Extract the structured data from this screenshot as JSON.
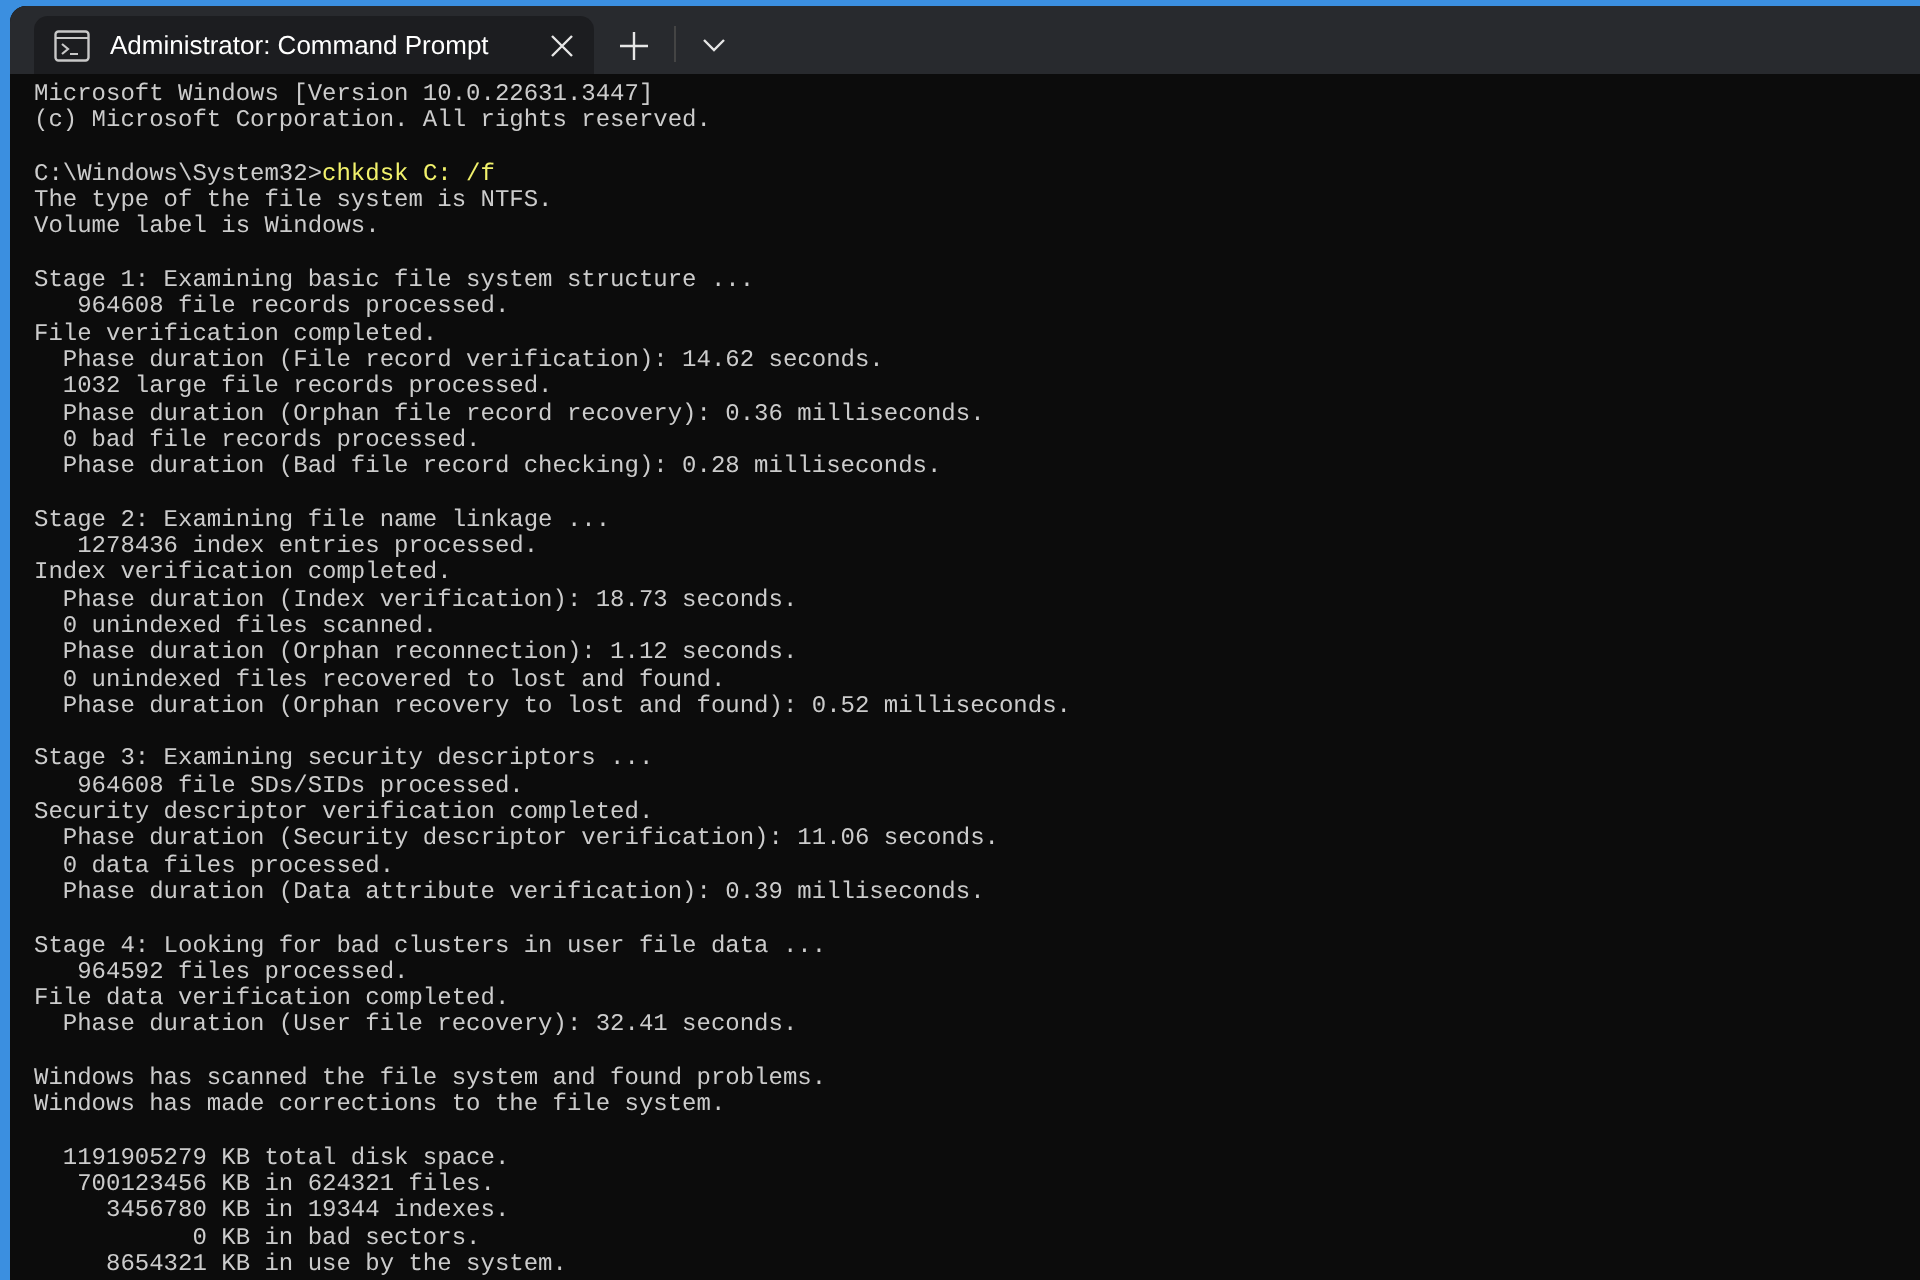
{
  "window": {
    "tabs": [
      {
        "title": "Administrator: Command Prompt",
        "selected": true
      }
    ]
  },
  "console": {
    "blocks": [
      [
        {
          "kind": "output",
          "text": "Microsoft Windows [Version 10.0.22631.3447]"
        },
        {
          "kind": "output",
          "text": "(c) Microsoft Corporation. All rights reserved."
        }
      ],
      [
        {
          "kind": "command",
          "prompt": "C:\\Windows\\System32>",
          "text": "chkdsk C: /f"
        },
        {
          "kind": "output",
          "text": "The type of the file system is NTFS."
        },
        {
          "kind": "output",
          "text": "Volume label is Windows."
        }
      ],
      [
        {
          "kind": "output",
          "text": "Stage 1: Examining basic file system structure ..."
        },
        {
          "kind": "output",
          "text": "   964608 file records processed."
        },
        {
          "kind": "output",
          "text": "File verification completed."
        },
        {
          "kind": "output",
          "text": "  Phase duration (File record verification): 14.62 seconds."
        },
        {
          "kind": "output",
          "text": "  1032 large file records processed."
        },
        {
          "kind": "output",
          "text": "  Phase duration (Orphan file record recovery): 0.36 milliseconds."
        },
        {
          "kind": "output",
          "text": "  0 bad file records processed."
        },
        {
          "kind": "output",
          "text": "  Phase duration (Bad file record checking): 0.28 milliseconds."
        }
      ],
      [
        {
          "kind": "output",
          "text": "Stage 2: Examining file name linkage ..."
        },
        {
          "kind": "output",
          "text": "   1278436 index entries processed."
        },
        {
          "kind": "output",
          "text": "Index verification completed."
        },
        {
          "kind": "output",
          "text": "  Phase duration (Index verification): 18.73 seconds."
        },
        {
          "kind": "output",
          "text": "  0 unindexed files scanned."
        },
        {
          "kind": "output",
          "text": "  Phase duration (Orphan reconnection): 1.12 seconds."
        },
        {
          "kind": "output",
          "text": "  0 unindexed files recovered to lost and found."
        },
        {
          "kind": "output",
          "text": "  Phase duration (Orphan recovery to lost and found): 0.52 milliseconds."
        }
      ],
      [
        {
          "kind": "output",
          "text": "Stage 3: Examining security descriptors ..."
        },
        {
          "kind": "output",
          "text": "   964608 file SDs/SIDs processed."
        },
        {
          "kind": "output",
          "text": "Security descriptor verification completed."
        },
        {
          "kind": "output",
          "text": "  Phase duration (Security descriptor verification): 11.06 seconds."
        },
        {
          "kind": "output",
          "text": "  0 data files processed."
        },
        {
          "kind": "output",
          "text": "  Phase duration (Data attribute verification): 0.39 milliseconds."
        }
      ],
      [
        {
          "kind": "output",
          "text": "Stage 4: Looking for bad clusters in user file data ..."
        },
        {
          "kind": "output",
          "text": "   964592 files processed."
        },
        {
          "kind": "output",
          "text": "File data verification completed."
        },
        {
          "kind": "output",
          "text": "  Phase duration (User file recovery): 32.41 seconds."
        }
      ],
      [
        {
          "kind": "output",
          "text": "Windows has scanned the file system and found problems."
        },
        {
          "kind": "output",
          "text": "Windows has made corrections to the file system."
        }
      ],
      [
        {
          "kind": "output",
          "text": "  1191905279 KB total disk space."
        },
        {
          "kind": "output",
          "text": "   700123456 KB in 624321 files."
        },
        {
          "kind": "output",
          "text": "     3456780 KB in 19344 indexes."
        },
        {
          "kind": "output",
          "text": "           0 KB in bad sectors."
        },
        {
          "kind": "output",
          "text": "     8654321 KB in use by the system."
        }
      ]
    ]
  }
}
